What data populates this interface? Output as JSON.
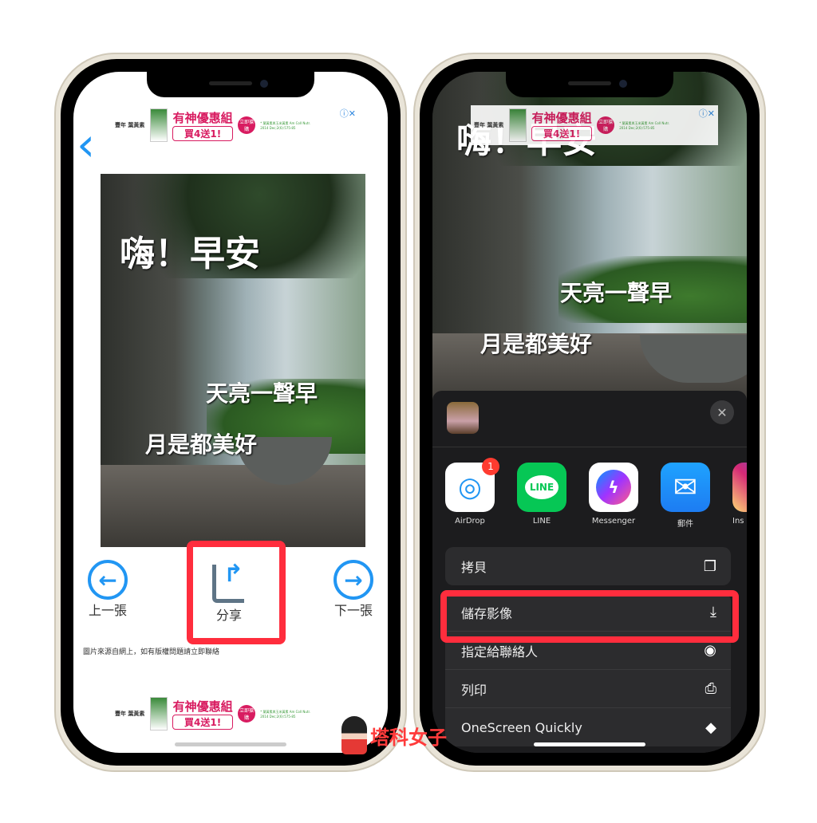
{
  "ad": {
    "brand": "豐年 葉黃素",
    "title": "有神優惠組",
    "offer": "買4送1!",
    "buy": "立即搶購",
    "fine": "* 葉黃素與玉米黃素 Am Coll Nutr. 2014 Dec;2(6):575-85",
    "close": "ⓘ✕"
  },
  "left": {
    "back": "‹",
    "photo_texts": [
      "嗨！早安",
      "天亮一聲早",
      "月是都美好"
    ],
    "prev_label": "上一張",
    "share_label": "分享",
    "next_label": "下一張",
    "credit": "圖片來源自網上，如有版權問題請立即聯絡"
  },
  "right": {
    "photo_texts": [
      "嗨！早安",
      "天亮一聲早",
      "月是都美好"
    ],
    "apps": [
      {
        "label": "AirDrop",
        "badge": "1"
      },
      {
        "label": "LINE",
        "icon_text": "LINE"
      },
      {
        "label": "Messenger"
      },
      {
        "label": "郵件"
      },
      {
        "label": "Ins"
      }
    ],
    "actions": [
      {
        "label": "拷貝",
        "icon": "copy-icon",
        "glyph": "❐"
      },
      {
        "label": "儲存影像",
        "icon": "save-image-icon",
        "glyph": "⤓"
      },
      {
        "label": "指定給聯絡人",
        "icon": "contact-icon",
        "glyph": "◉"
      },
      {
        "label": "列印",
        "icon": "printer-icon",
        "glyph": "⎙"
      },
      {
        "label": "OneScreen Quickly",
        "icon": "layers-icon",
        "glyph": "◆"
      }
    ]
  },
  "watermark": "塔科女子",
  "colors": {
    "highlight": "#ff2d3d",
    "accent": "#2196f3",
    "sheet": "#1c1c1e"
  }
}
